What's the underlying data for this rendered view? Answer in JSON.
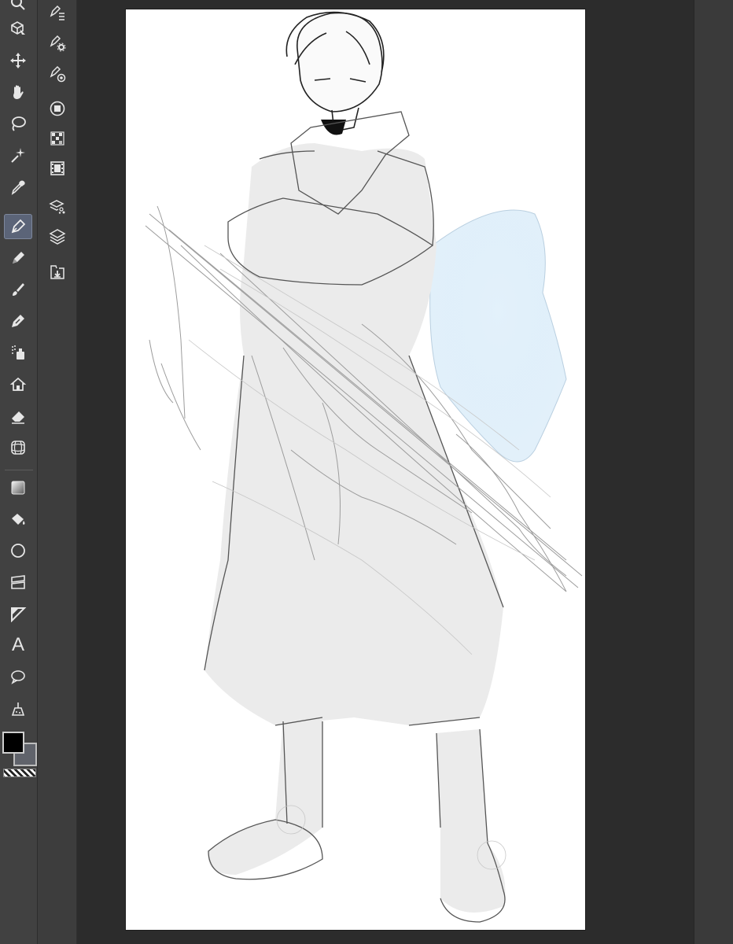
{
  "app": {
    "colors": {
      "tool_column_bg": "#414141",
      "sub_column_bg": "#3d3d3d",
      "workspace_bg": "#2c2c2c",
      "active_tool_highlight": "#5b6478",
      "canvas_bg": "#ffffff"
    }
  },
  "toolbar": {
    "tools": [
      {
        "name": "zoom",
        "icon": "zoom-icon"
      },
      {
        "name": "operation",
        "icon": "operation-cube-icon"
      },
      {
        "name": "move",
        "icon": "move-arrows-icon"
      },
      {
        "name": "hand",
        "icon": "hand-icon"
      },
      {
        "name": "lasso",
        "icon": "lasso-icon"
      },
      {
        "name": "auto-select",
        "icon": "magic-wand-icon"
      },
      {
        "name": "eyedropper",
        "icon": "eyedropper-icon"
      },
      {
        "name": "pen",
        "icon": "pen-nib-icon",
        "active": true
      },
      {
        "name": "pencil",
        "icon": "pencil-icon"
      },
      {
        "name": "brush",
        "icon": "brush-icon"
      },
      {
        "name": "airbrush",
        "icon": "airbrush-icon"
      },
      {
        "name": "spray",
        "icon": "spray-icon"
      },
      {
        "name": "decoration",
        "icon": "house-decoration-icon"
      },
      {
        "name": "eraser",
        "icon": "eraser-icon"
      },
      {
        "name": "blend",
        "icon": "grid-blend-icon"
      },
      {
        "name": "gradient",
        "icon": "gradient-icon"
      },
      {
        "name": "fill",
        "icon": "fill-bucket-icon"
      },
      {
        "name": "figure",
        "icon": "circle-figure-icon"
      },
      {
        "name": "frame",
        "icon": "frame-border-icon"
      },
      {
        "name": "ruler",
        "icon": "ruler-icon"
      },
      {
        "name": "text",
        "icon": "text-icon",
        "glyph": "A"
      },
      {
        "name": "balloon",
        "icon": "speech-balloon-icon"
      },
      {
        "name": "correct-line",
        "icon": "correct-line-icon"
      }
    ],
    "color_swatches": {
      "foreground": "#000000",
      "background": "#60636b"
    }
  },
  "subtools": {
    "items": [
      {
        "name": "sub-tool-list",
        "icon": "subtool-list-icon"
      },
      {
        "name": "sub-tool-settings",
        "icon": "subtool-settings-icon"
      },
      {
        "name": "sub-tool-detail",
        "icon": "subtool-detail-icon"
      },
      {
        "name": "color-wheel",
        "icon": "color-circle-icon"
      },
      {
        "name": "color-set",
        "icon": "color-set-icon"
      },
      {
        "name": "animation",
        "icon": "film-strip-icon"
      },
      {
        "name": "layer-property",
        "icon": "layer-property-icon"
      },
      {
        "name": "layers",
        "icon": "layers-stack-icon"
      },
      {
        "name": "material",
        "icon": "material-download-icon"
      }
    ]
  },
  "canvas": {
    "content": "sketch-illustration"
  }
}
